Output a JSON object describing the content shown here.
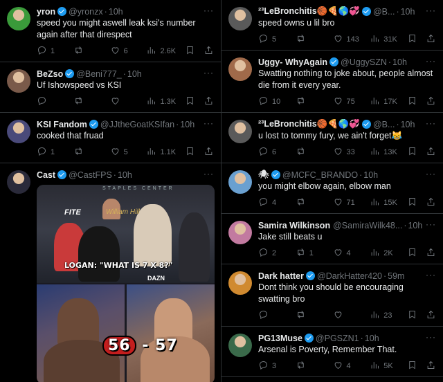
{
  "left_column": [
    {
      "name": "yron",
      "verified": true,
      "handle": "@yronzx",
      "time": "10h",
      "text": "speed you might aswell leak ksi's number again after that direspect",
      "replies": "1",
      "reposts": "",
      "likes": "6",
      "views": "2.6K",
      "avatar_color": "#3a9a3a"
    },
    {
      "name": "BeZso",
      "verified": true,
      "handle": "@Beni777_",
      "time": "10h",
      "text": "Uf Ishowspeed vs KSI",
      "replies": "",
      "reposts": "",
      "likes": "",
      "views": "1.3K",
      "avatar_color": "#7a5a4a"
    },
    {
      "name": "KSI Fandom",
      "verified": true,
      "handle": "@JJtheGoatKSIfan",
      "time": "10h",
      "text": "cooked that fruad",
      "replies": "1",
      "reposts": "",
      "likes": "5",
      "views": "1.1K",
      "avatar_color": "#4a4a7a"
    },
    {
      "name": "Cast",
      "verified": true,
      "handle": "@CastFPS",
      "time": "10h",
      "text": "",
      "avatar_color": "#2a2a3a",
      "media": {
        "arena_text": "STAPLES CENTER",
        "logo_left": "FITE",
        "logo_right": "William Hill",
        "caption": "LOGAN: \"WHAT IS 7 X 8?\"",
        "brand": "DAZN",
        "score_a": "56",
        "score_sep": "-",
        "score_b": "57"
      }
    }
  ],
  "right_column": [
    {
      "name": "²³LeBronchitis🏀🍕🌎💞",
      "verified": true,
      "handle": "@B...",
      "time": "10h",
      "text": "speed owns u lil bro",
      "replies": "5",
      "reposts": "",
      "likes": "143",
      "views": "31K",
      "avatar_color": "#5a5a5a"
    },
    {
      "name": "Uggy- WhyAgain",
      "verified": true,
      "handle": "@UggySZN",
      "time": "10h",
      "text": "Swatting nothing to joke about, people almost die from it every year.",
      "replies": "10",
      "reposts": "",
      "likes": "75",
      "views": "17K",
      "avatar_color": "#a06a4a"
    },
    {
      "name": "²³LeBronchitis🏀🍕🌎💞",
      "verified": true,
      "handle": "@B...",
      "time": "10h",
      "text": "u lost to tommy fury, we ain't forget😹",
      "replies": "6",
      "reposts": "",
      "likes": "33",
      "views": "13K",
      "avatar_color": "#5a5a5a"
    },
    {
      "name": "🕷",
      "verified": true,
      "handle": "@MCFC_BRANDO",
      "time": "10h",
      "text": "you might elbow again, elbow man",
      "replies": "4",
      "reposts": "",
      "likes": "71",
      "views": "15K",
      "avatar_color": "#6aa0d0"
    },
    {
      "name": "Samira Wilkinson",
      "verified": false,
      "handle": "@SamiraWilk48...",
      "time": "10h",
      "text": "Jake still beats u",
      "replies": "2",
      "reposts": "1",
      "likes": "4",
      "views": "2K",
      "avatar_color": "#c27aa0"
    },
    {
      "name": "Dark hatter",
      "verified": true,
      "handle": "@DarkHatter420",
      "time": "59m",
      "text": "Dont think you should be encouraging swatting bro",
      "replies": "",
      "reposts": "",
      "likes": "",
      "views": "23",
      "avatar_color": "#d08a30"
    },
    {
      "name": "PG13Muse",
      "verified": true,
      "handle": "@PGSZN1",
      "time": "10h",
      "text": "Arsenal is Poverty, Remember That.",
      "replies": "3",
      "reposts": "",
      "likes": "4",
      "views": "5K",
      "avatar_color": "#3a6a4a"
    }
  ],
  "icons": {
    "reply": "reply-icon",
    "repost": "repost-icon",
    "like": "heart-icon",
    "views": "views-icon",
    "bookmark": "bookmark-icon",
    "share": "share-icon",
    "more": "more-icon",
    "verified": "verified-badge-icon"
  },
  "colors": {
    "background": "#000000",
    "text": "#e7e9ea",
    "muted": "#71767b",
    "verified": "#1d9bf0",
    "divider": "#2f3336"
  }
}
